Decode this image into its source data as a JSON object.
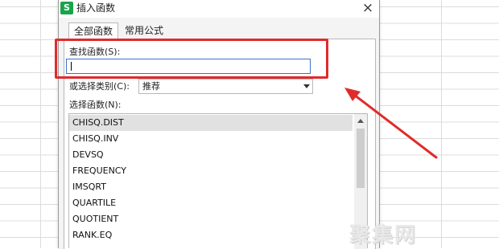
{
  "dialog": {
    "app_icon_letter": "S",
    "title": "插入函数",
    "close_symbol": "×"
  },
  "tabs": [
    {
      "label": "全部函数",
      "active": true
    },
    {
      "label": "常用公式",
      "active": false
    }
  ],
  "search": {
    "label": "查找函数(S):",
    "value": ""
  },
  "category": {
    "label": "或选择类别(C):",
    "selected": "推荐"
  },
  "functions": {
    "label": "选择函数(N):",
    "items": [
      "CHISQ.DIST",
      "CHISQ.INV",
      "DEVSQ",
      "FREQUENCY",
      "IMSQRT",
      "QUARTILE",
      "QUOTIENT",
      "RANK.EQ"
    ],
    "selected_index": 0
  },
  "annotation": {
    "color": "#e02b2b"
  },
  "watermark": {
    "text": "聚集网"
  }
}
